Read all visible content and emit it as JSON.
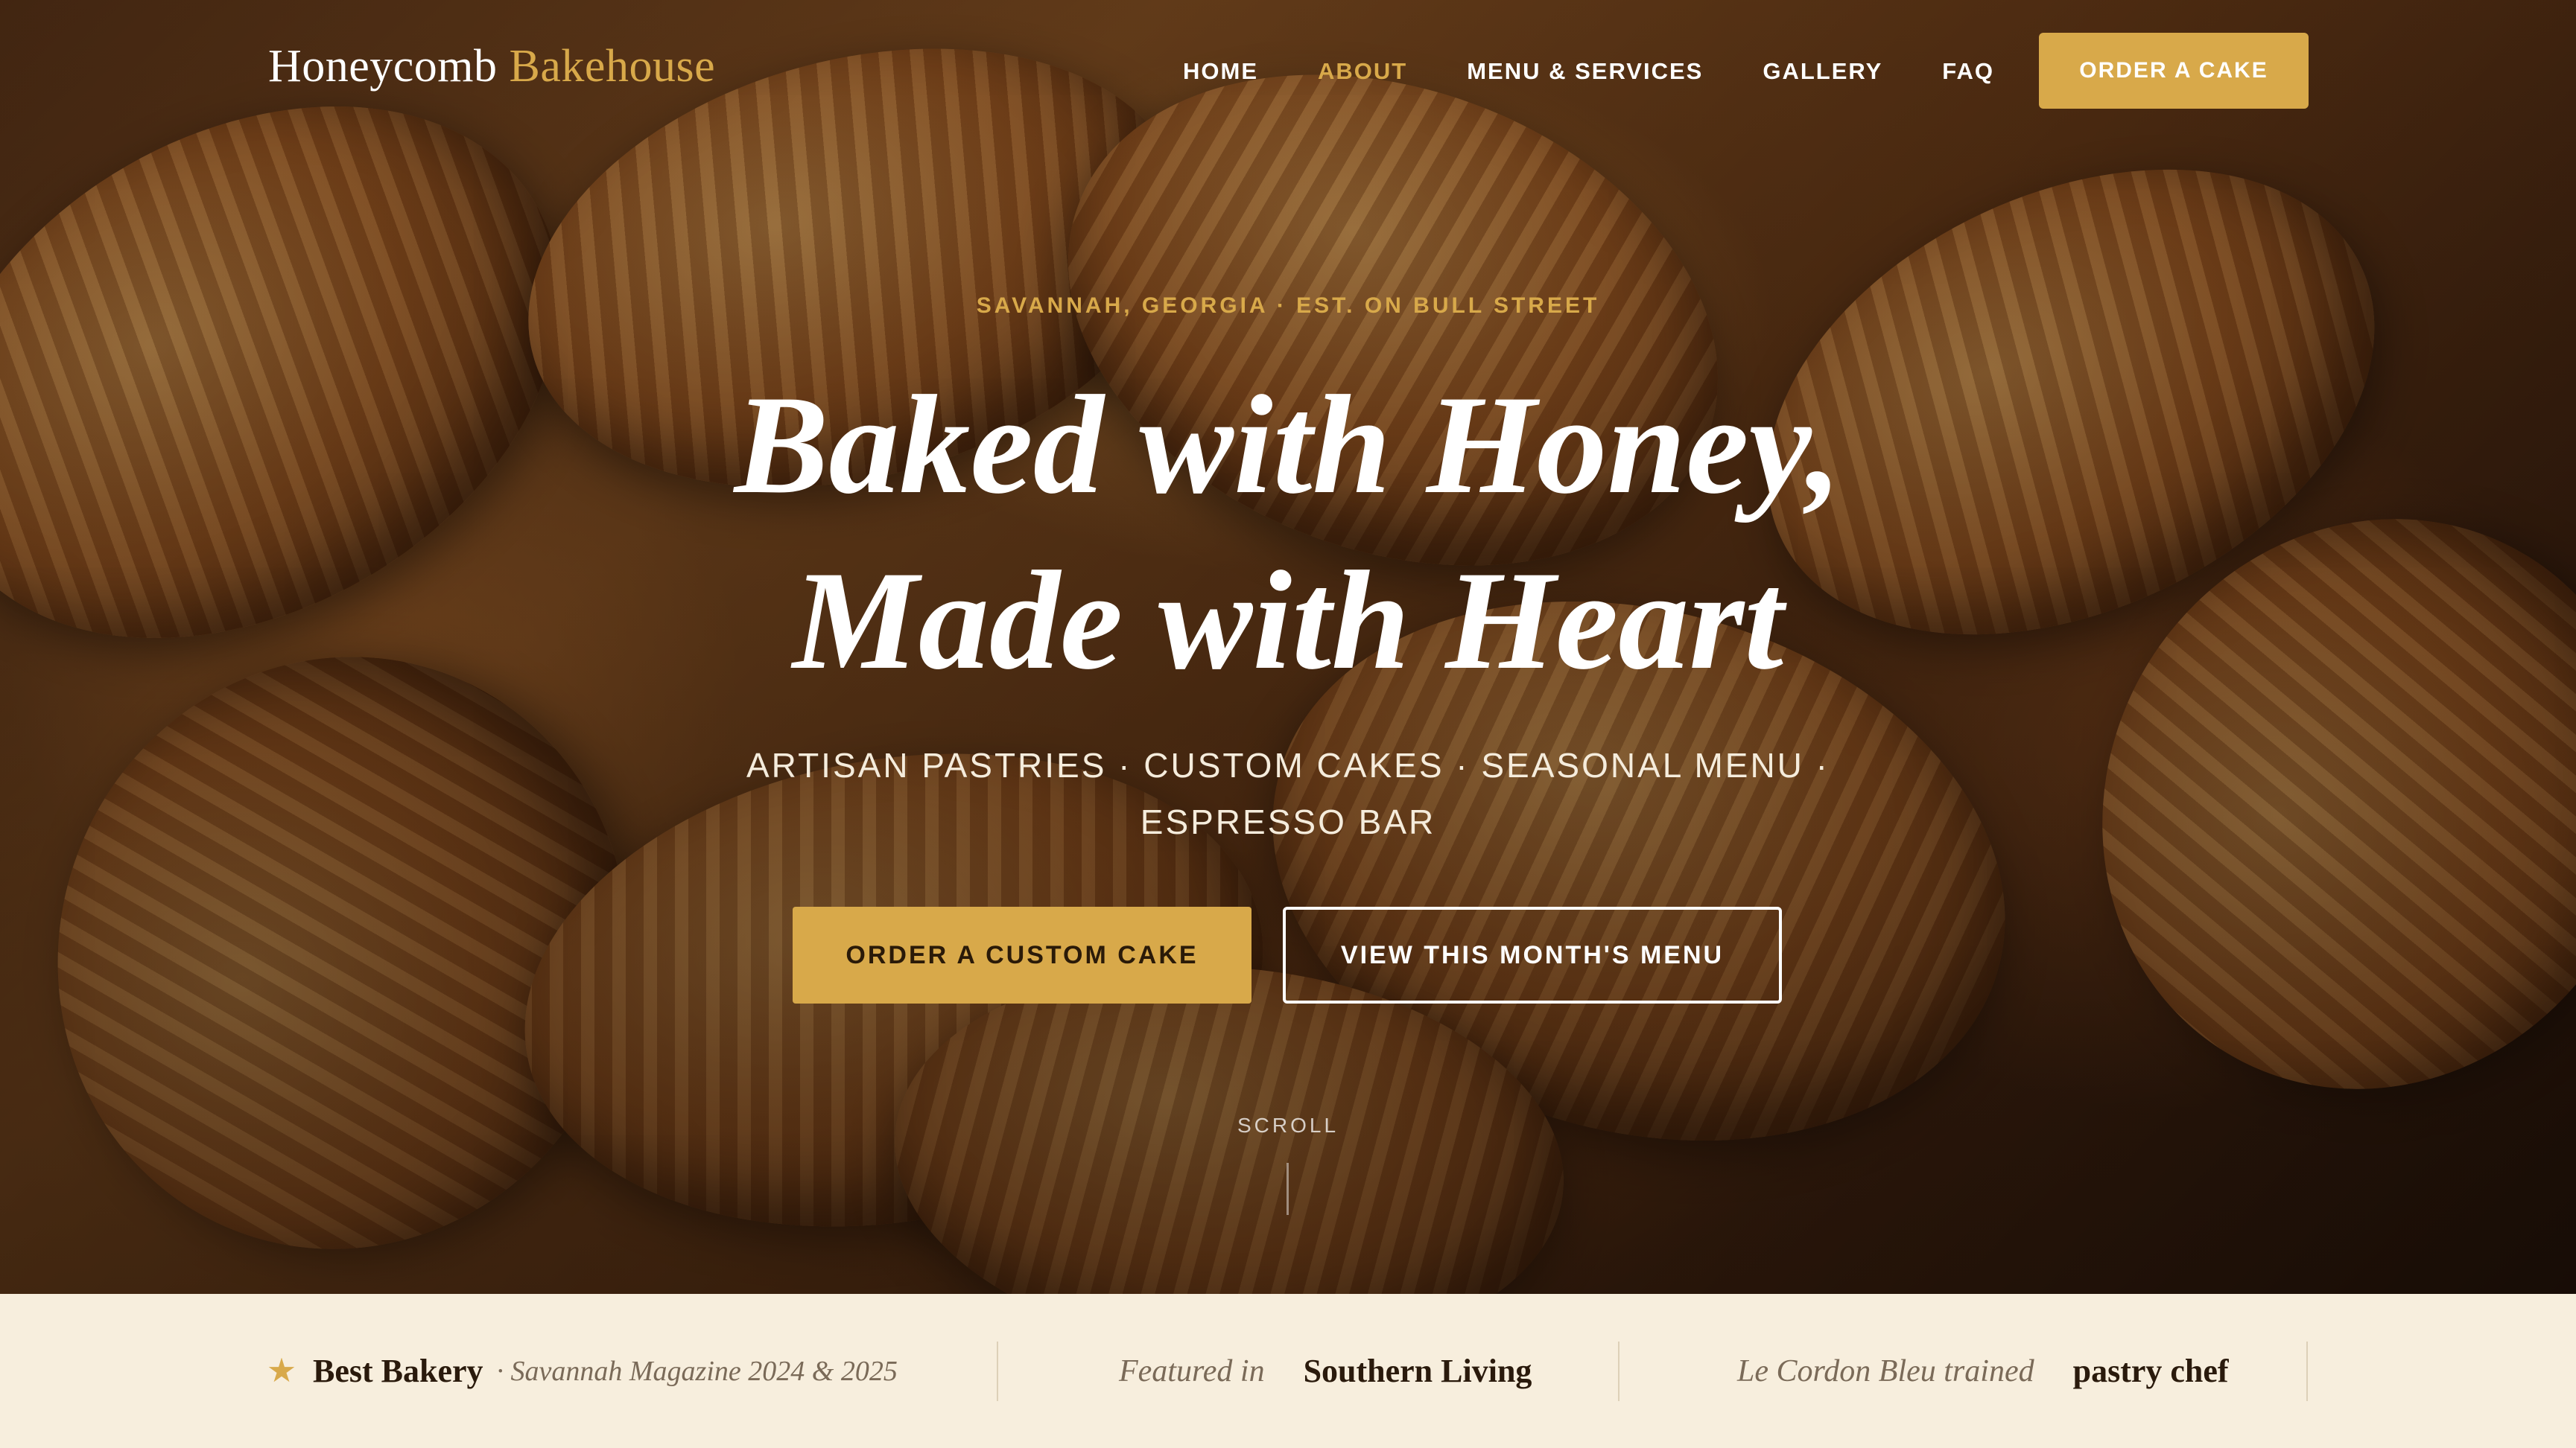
{
  "brand": {
    "name_primary": "Honeycomb",
    "name_accent": "Bakehouse"
  },
  "nav": {
    "links": [
      {
        "label": "HOME",
        "active": false
      },
      {
        "label": "ABOUT",
        "active": true
      },
      {
        "label": "MENU & SERVICES",
        "active": false
      },
      {
        "label": "GALLERY",
        "active": false
      },
      {
        "label": "FAQ",
        "active": false
      }
    ],
    "cta_label": "ORDER A CAKE"
  },
  "hero": {
    "eyebrow": "SAVANNAH, GEORGIA · EST. ON BULL STREET",
    "headline_line1": "Baked with Honey,",
    "headline_line2": "Made with Heart",
    "subline": "ARTISAN PASTRIES · CUSTOM CAKES · SEASONAL MENU · ESPRESSO BAR",
    "primary_button": "ORDER A CUSTOM CAKE",
    "secondary_button": "VIEW THIS MONTH'S MENU",
    "scroll_label": "SCROLL",
    "background_image": "croissants on wooden board"
  },
  "press": {
    "award_title": "Best Bakery",
    "award_source": "· Savannah Magazine 2024 & 2025",
    "featured_prefix": "Featured in",
    "featured_name": "Southern Living",
    "chef_prefix": "Le Cordon Bleu trained",
    "chef_title": "pastry chef",
    "award_icon": "star-icon"
  },
  "colors": {
    "accent": "#d8a94a",
    "press_background": "#f7eedd",
    "dark_text": "#2a1a0c"
  }
}
